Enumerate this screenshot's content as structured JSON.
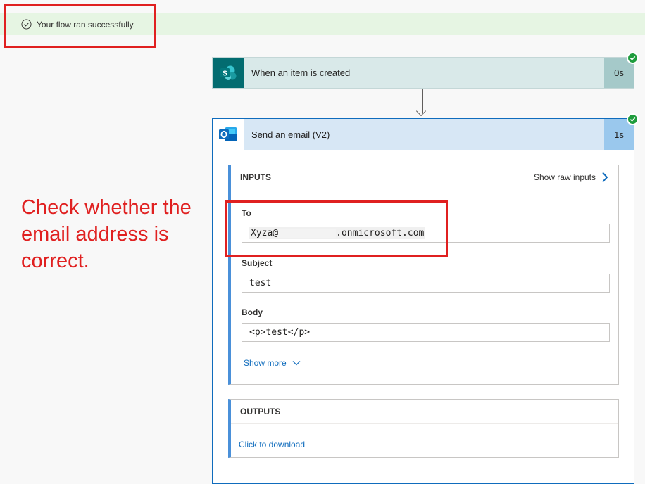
{
  "banner": {
    "message": "Your flow ran successfully."
  },
  "annotation": {
    "text": "Check whether the email address is correct."
  },
  "trigger": {
    "title": "When an item is created",
    "duration": "0s",
    "status": "succeeded"
  },
  "action": {
    "title": "Send an email (V2)",
    "duration": "1s",
    "status": "succeeded",
    "inputs": {
      "heading": "INPUTS",
      "show_raw_label": "Show raw inputs",
      "to_label": "To",
      "to_prefix": "Xyza@",
      "to_suffix": ".onmicrosoft.com",
      "subject_label": "Subject",
      "subject_value": "test",
      "body_label": "Body",
      "body_value": "<p>test</p>",
      "show_more_label": "Show more"
    },
    "outputs": {
      "heading": "OUTPUTS",
      "download_label": "Click to download"
    }
  },
  "colors": {
    "success_banner": "#e6f5e3",
    "sharepoint_teal": "#036c70",
    "outlook_blue": "#0f6cbd",
    "annotation_red": "#e02020",
    "success_green": "#1f9c3d"
  },
  "icons": [
    "check-circle-icon",
    "sharepoint-icon",
    "outlook-icon",
    "chevron-right-icon",
    "chevron-down-icon",
    "success-check-icon"
  ]
}
